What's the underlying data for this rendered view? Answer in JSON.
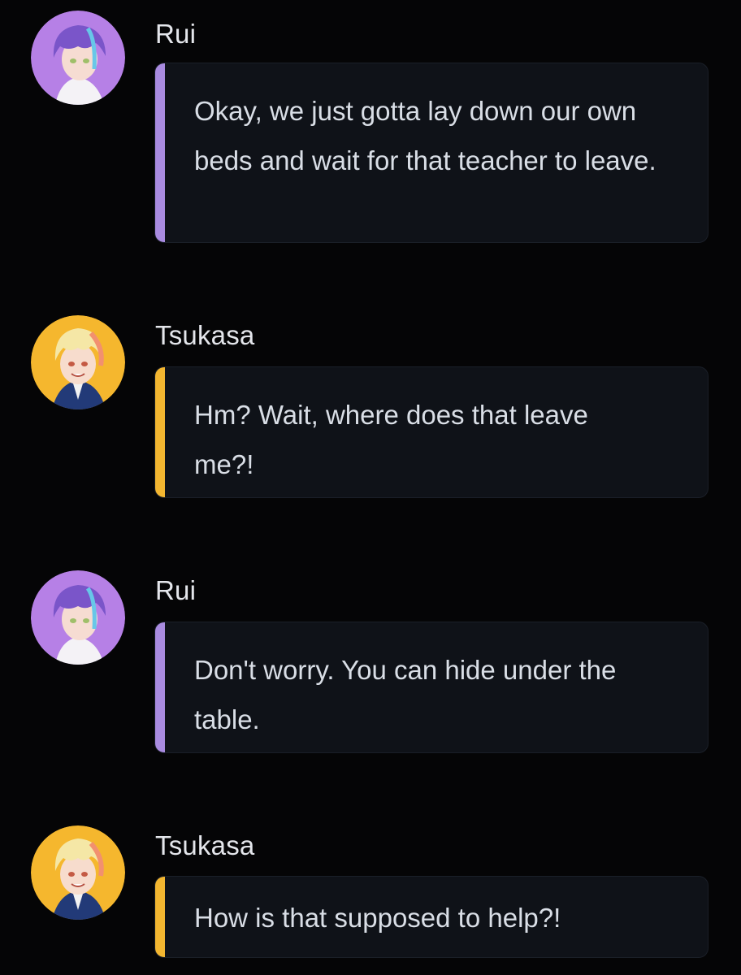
{
  "messages": [
    {
      "speaker": "Rui",
      "text": "Okay, we just gotta lay down our own beds and wait for that teacher to leave.",
      "accent": "#a98be0",
      "avatar_icon": "rui-avatar-icon"
    },
    {
      "speaker": "Tsukasa",
      "text": "Hm? Wait, where does that leave me?!",
      "accent": "#f3b630",
      "avatar_icon": "tsukasa-avatar-icon"
    },
    {
      "speaker": "Rui",
      "text": "Don't worry. You can hide under the table.",
      "accent": "#a98be0",
      "avatar_icon": "rui-avatar-icon"
    },
    {
      "speaker": "Tsukasa",
      "text": "How is that supposed to help?!",
      "accent": "#f3b630",
      "avatar_icon": "tsukasa-avatar-icon"
    }
  ],
  "colors": {
    "background": "#050506",
    "bubble": "#0f1218",
    "rui_accent": "#a98be0",
    "tsukasa_accent": "#f3b630"
  }
}
